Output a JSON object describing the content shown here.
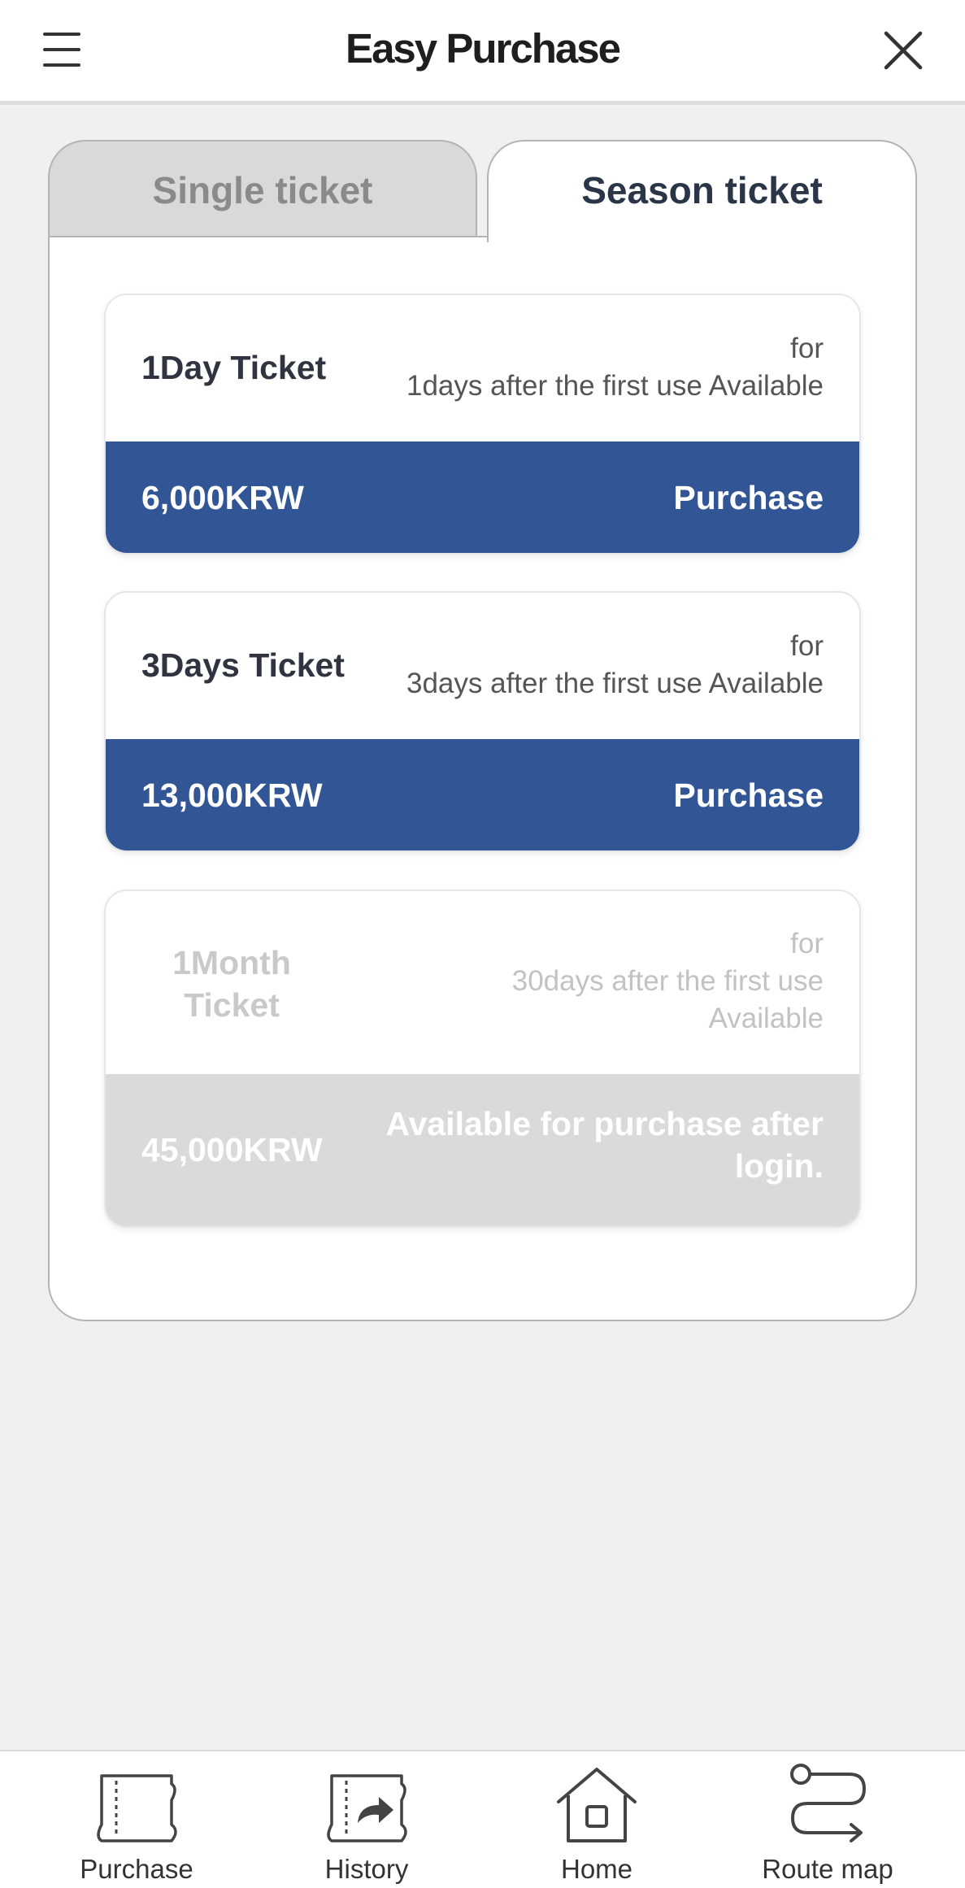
{
  "header": {
    "title": "Easy Purchase"
  },
  "tabs": [
    {
      "label": "Single ticket",
      "active": false
    },
    {
      "label": "Season ticket",
      "active": true
    }
  ],
  "tickets": [
    {
      "name": "1Day Ticket",
      "desc_line1": "for",
      "desc_line2": "1days after the first use Available",
      "price": "6,000KRW",
      "action": "Purchase"
    },
    {
      "name": "3Days Ticket",
      "desc_line1": "for",
      "desc_line2": "3days after the first use Available",
      "price": "13,000KRW",
      "action": "Purchase"
    },
    {
      "name_line1": "1Month",
      "name_line2": "Ticket",
      "desc_line1": "for",
      "desc_line2": "30days after the first use",
      "desc_line3": "Available",
      "price": "45,000KRW",
      "action_line1": "Available for purchase after",
      "action_line2": "login."
    }
  ],
  "colors": {
    "accent": "#315595",
    "disabled": "#dadada",
    "background": "#f0f0f0"
  },
  "bottom_nav": [
    {
      "label": "Purchase",
      "icon": "ticket-icon"
    },
    {
      "label": "History",
      "icon": "history-ticket-icon"
    },
    {
      "label": "Home",
      "icon": "home-icon"
    },
    {
      "label": "Route map",
      "icon": "route-map-icon"
    }
  ]
}
